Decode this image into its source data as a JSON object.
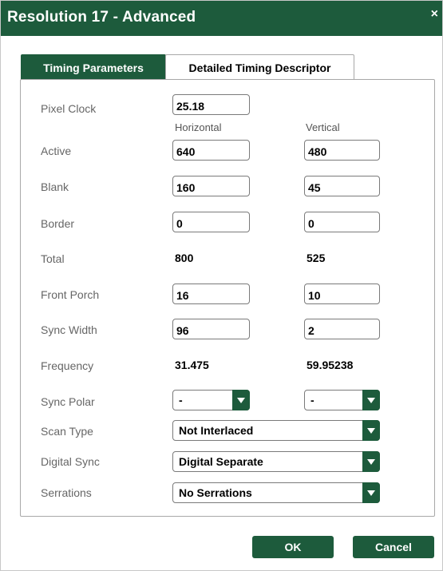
{
  "window": {
    "title": "Resolution 17 - Advanced",
    "close_glyph": "×"
  },
  "tabs": [
    {
      "label": "Timing Parameters",
      "active": true
    },
    {
      "label": "Detailed Timing Descriptor",
      "active": false
    }
  ],
  "form": {
    "pixel_clock": {
      "label": "Pixel Clock",
      "value": "25.18"
    },
    "col_headers": {
      "horizontal": "Horizontal",
      "vertical": "Vertical"
    },
    "active": {
      "label": "Active",
      "h": "640",
      "v": "480"
    },
    "blank": {
      "label": "Blank",
      "h": "160",
      "v": "45"
    },
    "border": {
      "label": "Border",
      "h": "0",
      "v": "0"
    },
    "total": {
      "label": "Total",
      "h": "800",
      "v": "525"
    },
    "front_porch": {
      "label": "Front Porch",
      "h": "16",
      "v": "10"
    },
    "sync_width": {
      "label": "Sync Width",
      "h": "96",
      "v": "2"
    },
    "frequency": {
      "label": "Frequency",
      "h": "31.475",
      "v": "59.95238"
    },
    "sync_polar": {
      "label": "Sync Polar",
      "h": "-",
      "v": "-"
    },
    "scan_type": {
      "label": "Scan Type",
      "value": "Not Interlaced"
    },
    "digital_sync": {
      "label": "Digital Sync",
      "value": "Digital Separate"
    },
    "serrations": {
      "label": "Serrations",
      "value": "No Serrations"
    }
  },
  "buttons": {
    "ok": "OK",
    "cancel": "Cancel"
  },
  "colors": {
    "accent": "#1d5b3c"
  }
}
